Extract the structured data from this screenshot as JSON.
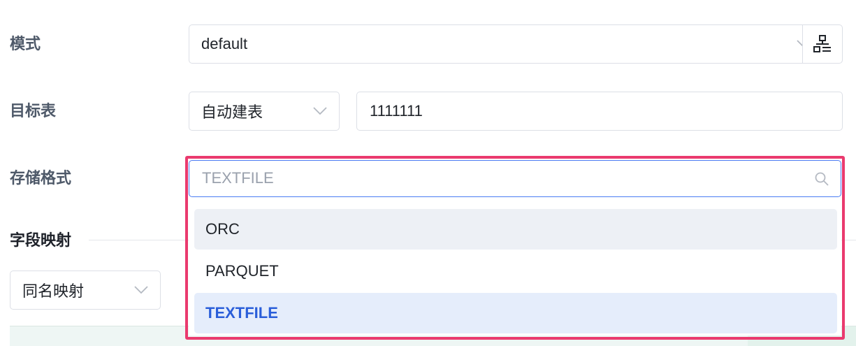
{
  "form": {
    "mode": {
      "label": "模式",
      "value": "default",
      "chevron_icon": "chevron-down-icon",
      "button_icon": "hierarchy-icon"
    },
    "target_table": {
      "label": "目标表",
      "select_value": "自动建表",
      "input_value": "1111111"
    },
    "storage_format": {
      "label": "存储格式",
      "search_placeholder": "TEXTFILE",
      "search_icon": "search-icon",
      "options": [
        {
          "label": "ORC",
          "state": "hover"
        },
        {
          "label": "PARQUET",
          "state": "normal"
        },
        {
          "label": "TEXTFILE",
          "state": "selected"
        }
      ]
    }
  },
  "field_mapping": {
    "section_title": "字段映射",
    "strategy_value": "同名映射"
  },
  "colors": {
    "accent": "#2a5ed9",
    "focus_border": "#4b7cf3",
    "highlight_border": "#ea3a6e",
    "label_text": "#4e5969"
  }
}
